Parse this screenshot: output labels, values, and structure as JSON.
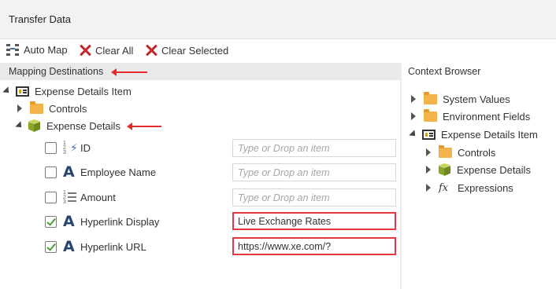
{
  "window": {
    "title": "Transfer Data"
  },
  "toolbar": {
    "auto_map_label": "Auto Map",
    "clear_all_label": "Clear All",
    "clear_selected_label": "Clear Selected"
  },
  "left_panel": {
    "header": "Mapping Destinations",
    "root": {
      "label": "Expense Details Item",
      "icon": "form-item-icon"
    },
    "controls": {
      "label": "Controls",
      "icon": "folder-icon"
    },
    "expense_details": {
      "label": "Expense Details",
      "icon": "cube-icon"
    },
    "fields": [
      {
        "label": "ID",
        "checked": false,
        "icon": "autonumber-icon",
        "value": "",
        "placeholder": "Type or Drop an item"
      },
      {
        "label": "Employee Name",
        "checked": false,
        "icon": "text-icon",
        "value": "",
        "placeholder": "Type or Drop an item"
      },
      {
        "label": "Amount",
        "checked": false,
        "icon": "number-icon",
        "value": "",
        "placeholder": "Type or Drop an item"
      },
      {
        "label": "Hyperlink Display",
        "checked": true,
        "icon": "text-icon",
        "value": "Live Exchange Rates",
        "placeholder": ""
      },
      {
        "label": "Hyperlink URL",
        "checked": true,
        "icon": "text-icon",
        "value": "https://www.xe.com/?",
        "placeholder": ""
      }
    ]
  },
  "right_panel": {
    "header": "Context Browser",
    "items": [
      {
        "label": "System Values",
        "icon": "folder-icon"
      },
      {
        "label": "Environment Fields",
        "icon": "folder-icon"
      },
      {
        "label": "Expense Details Item",
        "icon": "form-item-icon"
      },
      {
        "label": "Controls",
        "icon": "folder-icon"
      },
      {
        "label": "Expense Details",
        "icon": "cube-icon"
      },
      {
        "label": "Expressions",
        "icon": "fx-icon"
      }
    ]
  },
  "colors": {
    "highlight": "#e5393f",
    "arrow": "#e32b2b",
    "check": "#4aa031",
    "text_icon": "#27456e"
  }
}
